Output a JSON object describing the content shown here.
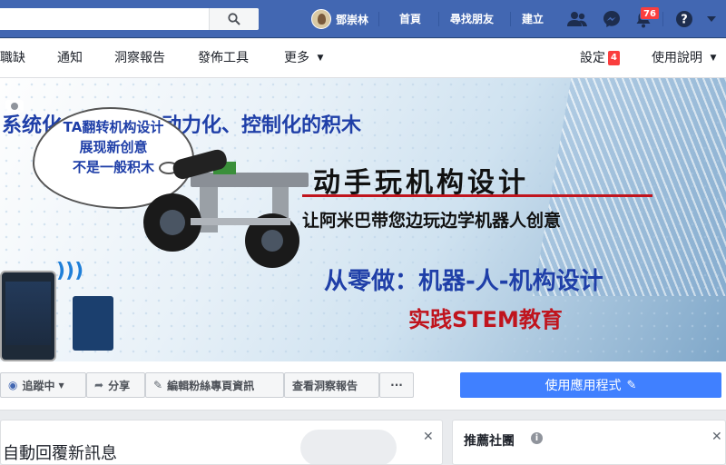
{
  "topbar": {
    "search_placeholder": "",
    "profile_name": "鄧崇林",
    "links": [
      "首頁",
      "尋找朋友",
      "建立"
    ],
    "notifications_count": "76"
  },
  "subnav": {
    "left_items": [
      "職缺",
      "通知",
      "洞察報告",
      "發佈工具",
      "更多"
    ],
    "settings_label": "設定",
    "settings_count": "4",
    "help_label": "使用說明"
  },
  "cover": {
    "line1": "系统化、平台化、动力化、控制化的积木",
    "title": "动手玩机构设计",
    "subtitle": "让阿米巴带您边玩边学机器人创意",
    "bubble": [
      "TA翻转机构设计",
      "展现新创意",
      "不是一般积木"
    ],
    "line3": "从零做：机器-人-机构设计",
    "line4": "实践STEM教育"
  },
  "actions": {
    "following_label": "追蹤中",
    "share_label": "分享",
    "edit_label": "編輯粉絲專頁資訊",
    "insights_label": "查看洞察報告",
    "more_label": "···",
    "app_label": "使用應用程式"
  },
  "cards": {
    "left_title": "自動回覆新訊息",
    "right_title": "推薦社團"
  },
  "colors": {
    "brand": "#4267b2",
    "accent": "#4080ff",
    "badge": "#fa3e3e"
  }
}
